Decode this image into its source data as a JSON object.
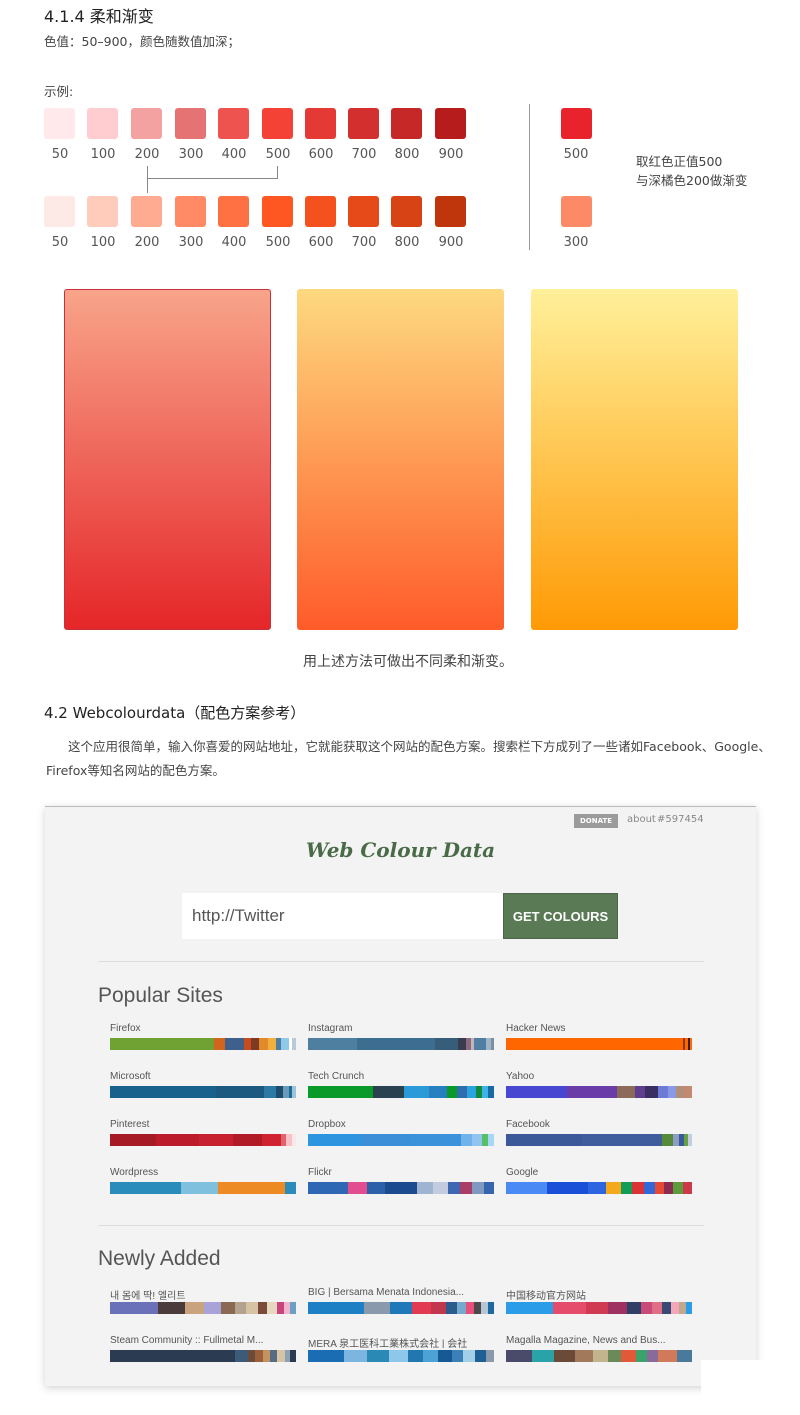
{
  "section_414": {
    "title": "4.1.4 柔和渐变",
    "subtitle": "色值：50–900，颜色随数值加深；",
    "example_label": "示例:",
    "red_row": [
      {
        "label": "50",
        "color": "#ffe9ea"
      },
      {
        "label": "100",
        "color": "#ffcdd0"
      },
      {
        "label": "200",
        "color": "#f3a1a1"
      },
      {
        "label": "300",
        "color": "#e57373"
      },
      {
        "label": "400",
        "color": "#ef5350"
      },
      {
        "label": "500",
        "color": "#f44336"
      },
      {
        "label": "600",
        "color": "#e53935"
      },
      {
        "label": "700",
        "color": "#d32f2f"
      },
      {
        "label": "800",
        "color": "#c62828"
      },
      {
        "label": "900",
        "color": "#b71c1c"
      }
    ],
    "orange_row": [
      {
        "label": "50",
        "color": "#fdeae7"
      },
      {
        "label": "100",
        "color": "#ffccbc"
      },
      {
        "label": "200",
        "color": "#ffab91"
      },
      {
        "label": "300",
        "color": "#ff8a65"
      },
      {
        "label": "400",
        "color": "#ff7043"
      },
      {
        "label": "500",
        "color": "#ff5722"
      },
      {
        "label": "600",
        "color": "#f4511e"
      },
      {
        "label": "700",
        "color": "#e64a19"
      },
      {
        "label": "800",
        "color": "#d84315"
      },
      {
        "label": "900",
        "color": "#bf360c"
      }
    ],
    "pick_red": {
      "label": "500",
      "color": "#e8232b"
    },
    "pick_orange": {
      "label": "300",
      "color": "#fd8a66"
    },
    "note_line1": "取红色正值500",
    "note_line2": "与深橘色200做渐变",
    "gradient_caption": "用上述方法可做出不同柔和渐变。"
  },
  "section_42": {
    "title": "4.2  Webcolourdata（配色方案参考）",
    "paragraph": "这个应用很简单，输入你喜爱的网站地址，它就能获取这个网站的配色方案。搜索栏下方成列了一些诸如Facebook、Google、Firefox等知名网站的配色方案。"
  },
  "wcd": {
    "donate": "DONATE",
    "about": "about",
    "hex": "#597454",
    "logo": "Web Colour Data",
    "input_value": "http://Twitter",
    "button": "GET COLOURS",
    "popular_title": "Popular Sites",
    "newly_title": "Newly Added",
    "popular": [
      {
        "name": "Firefox",
        "colors": [
          [
            "#6fa232",
            56
          ],
          [
            "#d1651c",
            6
          ],
          [
            "#3f608c",
            10
          ],
          [
            "#c64b1e",
            4
          ],
          [
            "#7c3c23",
            4
          ],
          [
            "#e28a2a",
            5
          ],
          [
            "#f1b03b",
            4
          ],
          [
            "#4c7ba3",
            3
          ],
          [
            "#8fc9e8",
            4
          ],
          [
            "#ffffff",
            2
          ],
          [
            "#b9c9d8",
            2
          ]
        ]
      },
      {
        "name": "Instagram",
        "colors": [
          [
            "#4e7ea0",
            30
          ],
          [
            "#3d6d91",
            48
          ],
          [
            "#365d7a",
            14
          ],
          [
            "#3b3b4f",
            5
          ],
          [
            "#8a6b7d",
            3
          ],
          [
            "#c2b4b8",
            2
          ],
          [
            "#507fa3",
            7
          ],
          [
            "#9fb6c8",
            3
          ],
          [
            "#7a8fa0",
            2
          ]
        ]
      },
      {
        "name": "Hacker News",
        "colors": [
          [
            "#ff6600",
            95
          ],
          [
            "#8a3a10",
            1
          ],
          [
            "#ff6600",
            2
          ],
          [
            "#3a1a0a",
            1
          ],
          [
            "#ff6a00",
            1
          ]
        ]
      },
      {
        "name": "Microsoft",
        "colors": [
          [
            "#17618c",
            57
          ],
          [
            "#1b5980",
            26
          ],
          [
            "#2d79a5",
            6
          ],
          [
            "#1e4c6c",
            4
          ],
          [
            "#6a9bbb",
            3
          ],
          [
            "#1f6a95",
            2
          ],
          [
            "#9ec4db",
            2
          ]
        ]
      },
      {
        "name": "Tech Crunch",
        "colors": [
          [
            "#0a9a29",
            32
          ],
          [
            "#2a4150",
            15
          ],
          [
            "#2a9ad8",
            12
          ],
          [
            "#2680bf",
            9
          ],
          [
            "#0a9a29",
            5
          ],
          [
            "#2e6eaf",
            5
          ],
          [
            "#2aa3e0",
            4
          ],
          [
            "#0f8c3b",
            3
          ],
          [
            "#3db3e8",
            3
          ],
          [
            "#166aa0",
            3
          ]
        ]
      },
      {
        "name": "Yahoo",
        "colors": [
          [
            "#4747d1",
            30
          ],
          [
            "#6a3ca8",
            25
          ],
          [
            "#8b6a5a",
            9
          ],
          [
            "#5f3e8f",
            5
          ],
          [
            "#3a2f60",
            6
          ],
          [
            "#6b7bd8",
            5
          ],
          [
            "#8899e6",
            4
          ],
          [
            "#b28d78",
            4
          ],
          [
            "#c38a73",
            4
          ]
        ]
      },
      {
        "name": "Pinterest",
        "colors": [
          [
            "#a51a24",
            24
          ],
          [
            "#bc1c2a",
            23
          ],
          [
            "#c7202e",
            18
          ],
          [
            "#b01b27",
            15
          ],
          [
            "#cf2331",
            10
          ],
          [
            "#e1626d",
            3
          ],
          [
            "#f5c3c7",
            3
          ],
          [
            "#fae5e7",
            2
          ]
        ]
      },
      {
        "name": "Dropbox",
        "colors": [
          [
            "#2d94e0",
            27
          ],
          [
            "#3b8ed8",
            25
          ],
          [
            "#3a92db",
            26
          ],
          [
            "#6fb3ea",
            6
          ],
          [
            "#8fc5f0",
            5
          ],
          [
            "#57c064",
            3
          ],
          [
            "#a8d6f5",
            3
          ]
        ]
      },
      {
        "name": "Facebook",
        "colors": [
          [
            "#3b5998",
            40
          ],
          [
            "#3f5d9c",
            42
          ],
          [
            "#56893b",
            6
          ],
          [
            "#8b9dc3",
            3
          ],
          [
            "#3b5998",
            3
          ],
          [
            "#67a044",
            2
          ],
          [
            "#c3cde0",
            2
          ]
        ]
      },
      {
        "name": "Wordpress",
        "colors": [
          [
            "#2a8cba",
            38
          ],
          [
            "#7fc0de",
            20
          ],
          [
            "#ee8a23",
            36
          ],
          [
            "#2a8cba",
            6
          ]
        ]
      },
      {
        "name": "Flickr",
        "colors": [
          [
            "#2e67b3",
            20
          ],
          [
            "#e14d8f",
            10
          ],
          [
            "#2c60a8",
            9
          ],
          [
            "#1c4c8f",
            16
          ],
          [
            "#9fb4d1",
            8
          ],
          [
            "#c2ccde",
            8
          ],
          [
            "#3d67b0",
            6
          ],
          [
            "#aa3d68",
            6
          ],
          [
            "#8099c1",
            6
          ],
          [
            "#3566ad",
            5
          ]
        ]
      },
      {
        "name": "Google",
        "colors": [
          [
            "#4a8af4",
            22
          ],
          [
            "#1c4fd8",
            22
          ],
          [
            "#2d64e0",
            10
          ],
          [
            "#f4a91d",
            8
          ],
          [
            "#109d58",
            6
          ],
          [
            "#db3236",
            6
          ],
          [
            "#3367d6",
            6
          ],
          [
            "#e64a35",
            5
          ],
          [
            "#8b2b50",
            5
          ],
          [
            "#5c9c3b",
            5
          ],
          [
            "#cc3a4a",
            5
          ]
        ]
      }
    ],
    "newly": [
      {
        "name": "내 몸에 딱! 엘리트",
        "colors": [
          [
            "#6b71b8",
            25
          ],
          [
            "#4b3b3a",
            14
          ],
          [
            "#c9a37e",
            10
          ],
          [
            "#a7a3d8",
            9
          ],
          [
            "#8a6953",
            7
          ],
          [
            "#b3a28e",
            6
          ],
          [
            "#d6c3a3",
            6
          ],
          [
            "#7a4b3a",
            5
          ],
          [
            "#e6d7c0",
            5
          ],
          [
            "#c9437c",
            4
          ],
          [
            "#f2b5d0",
            3
          ],
          [
            "#6ba0c3",
            3
          ]
        ]
      },
      {
        "name": "BIG | Bersama Menata Indonesia...",
        "colors": [
          [
            "#1e80c4",
            30
          ],
          [
            "#8a99ab",
            14
          ],
          [
            "#2178b8",
            12
          ],
          [
            "#e23a52",
            10
          ],
          [
            "#c1384d",
            8
          ],
          [
            "#2a5c8c",
            6
          ],
          [
            "#76a9cd",
            5
          ],
          [
            "#e9517a",
            4
          ],
          [
            "#4a4a4a",
            4
          ],
          [
            "#b7c5d4",
            4
          ],
          [
            "#1c6aa0",
            3
          ]
        ]
      },
      {
        "name": "中国移动官方网站",
        "colors": [
          [
            "#2a9ce8",
            25
          ],
          [
            "#e54b6a",
            17
          ],
          [
            "#d03b53",
            12
          ],
          [
            "#9e3160",
            10
          ],
          [
            "#2f3f66",
            7
          ],
          [
            "#c94a78",
            6
          ],
          [
            "#e06c85",
            5
          ],
          [
            "#3b4a74",
            5
          ],
          [
            "#f4a7b9",
            4
          ],
          [
            "#c0a88c",
            4
          ],
          [
            "#2a9ce8",
            3
          ]
        ]
      },
      {
        "name": "Steam Community :: Fullmetal M...",
        "colors": [
          [
            "#2a3b52",
            67
          ],
          [
            "#3d5a78",
            7
          ],
          [
            "#6b4b3a",
            4
          ],
          [
            "#9b5f3b",
            4
          ],
          [
            "#c3925f",
            4
          ],
          [
            "#556b86",
            4
          ],
          [
            "#d7c4a3",
            4
          ],
          [
            "#8aa1b8",
            3
          ],
          [
            "#2b3a4f",
            3
          ]
        ]
      },
      {
        "name": "MERA 泉工医科工業株式会社 | 会社",
        "colors": [
          [
            "#1a6db3",
            19
          ],
          [
            "#7cb6e0",
            12
          ],
          [
            "#2a8ab5",
            11
          ],
          [
            "#8ec7ea",
            10
          ],
          [
            "#2377b0",
            8
          ],
          [
            "#4aa3d4",
            8
          ],
          [
            "#155a94",
            7
          ],
          [
            "#3c80b8",
            6
          ],
          [
            "#a3cfe8",
            6
          ],
          [
            "#1e5f96",
            6
          ],
          [
            "#8a9aab",
            4
          ]
        ]
      },
      {
        "name": "Magalla Magazine, News and Bus...",
        "colors": [
          [
            "#4a4a6a",
            14
          ],
          [
            "#2aa3a8",
            12
          ],
          [
            "#6b4a3a",
            11
          ],
          [
            "#a3795b",
            10
          ],
          [
            "#c2b58e",
            8
          ],
          [
            "#6b8a5a",
            7
          ],
          [
            "#e05a3a",
            8
          ],
          [
            "#3aa36a",
            6
          ],
          [
            "#8a6a9b",
            6
          ],
          [
            "#d07a5a",
            10
          ],
          [
            "#4a7a9b",
            8
          ]
        ]
      }
    ]
  }
}
